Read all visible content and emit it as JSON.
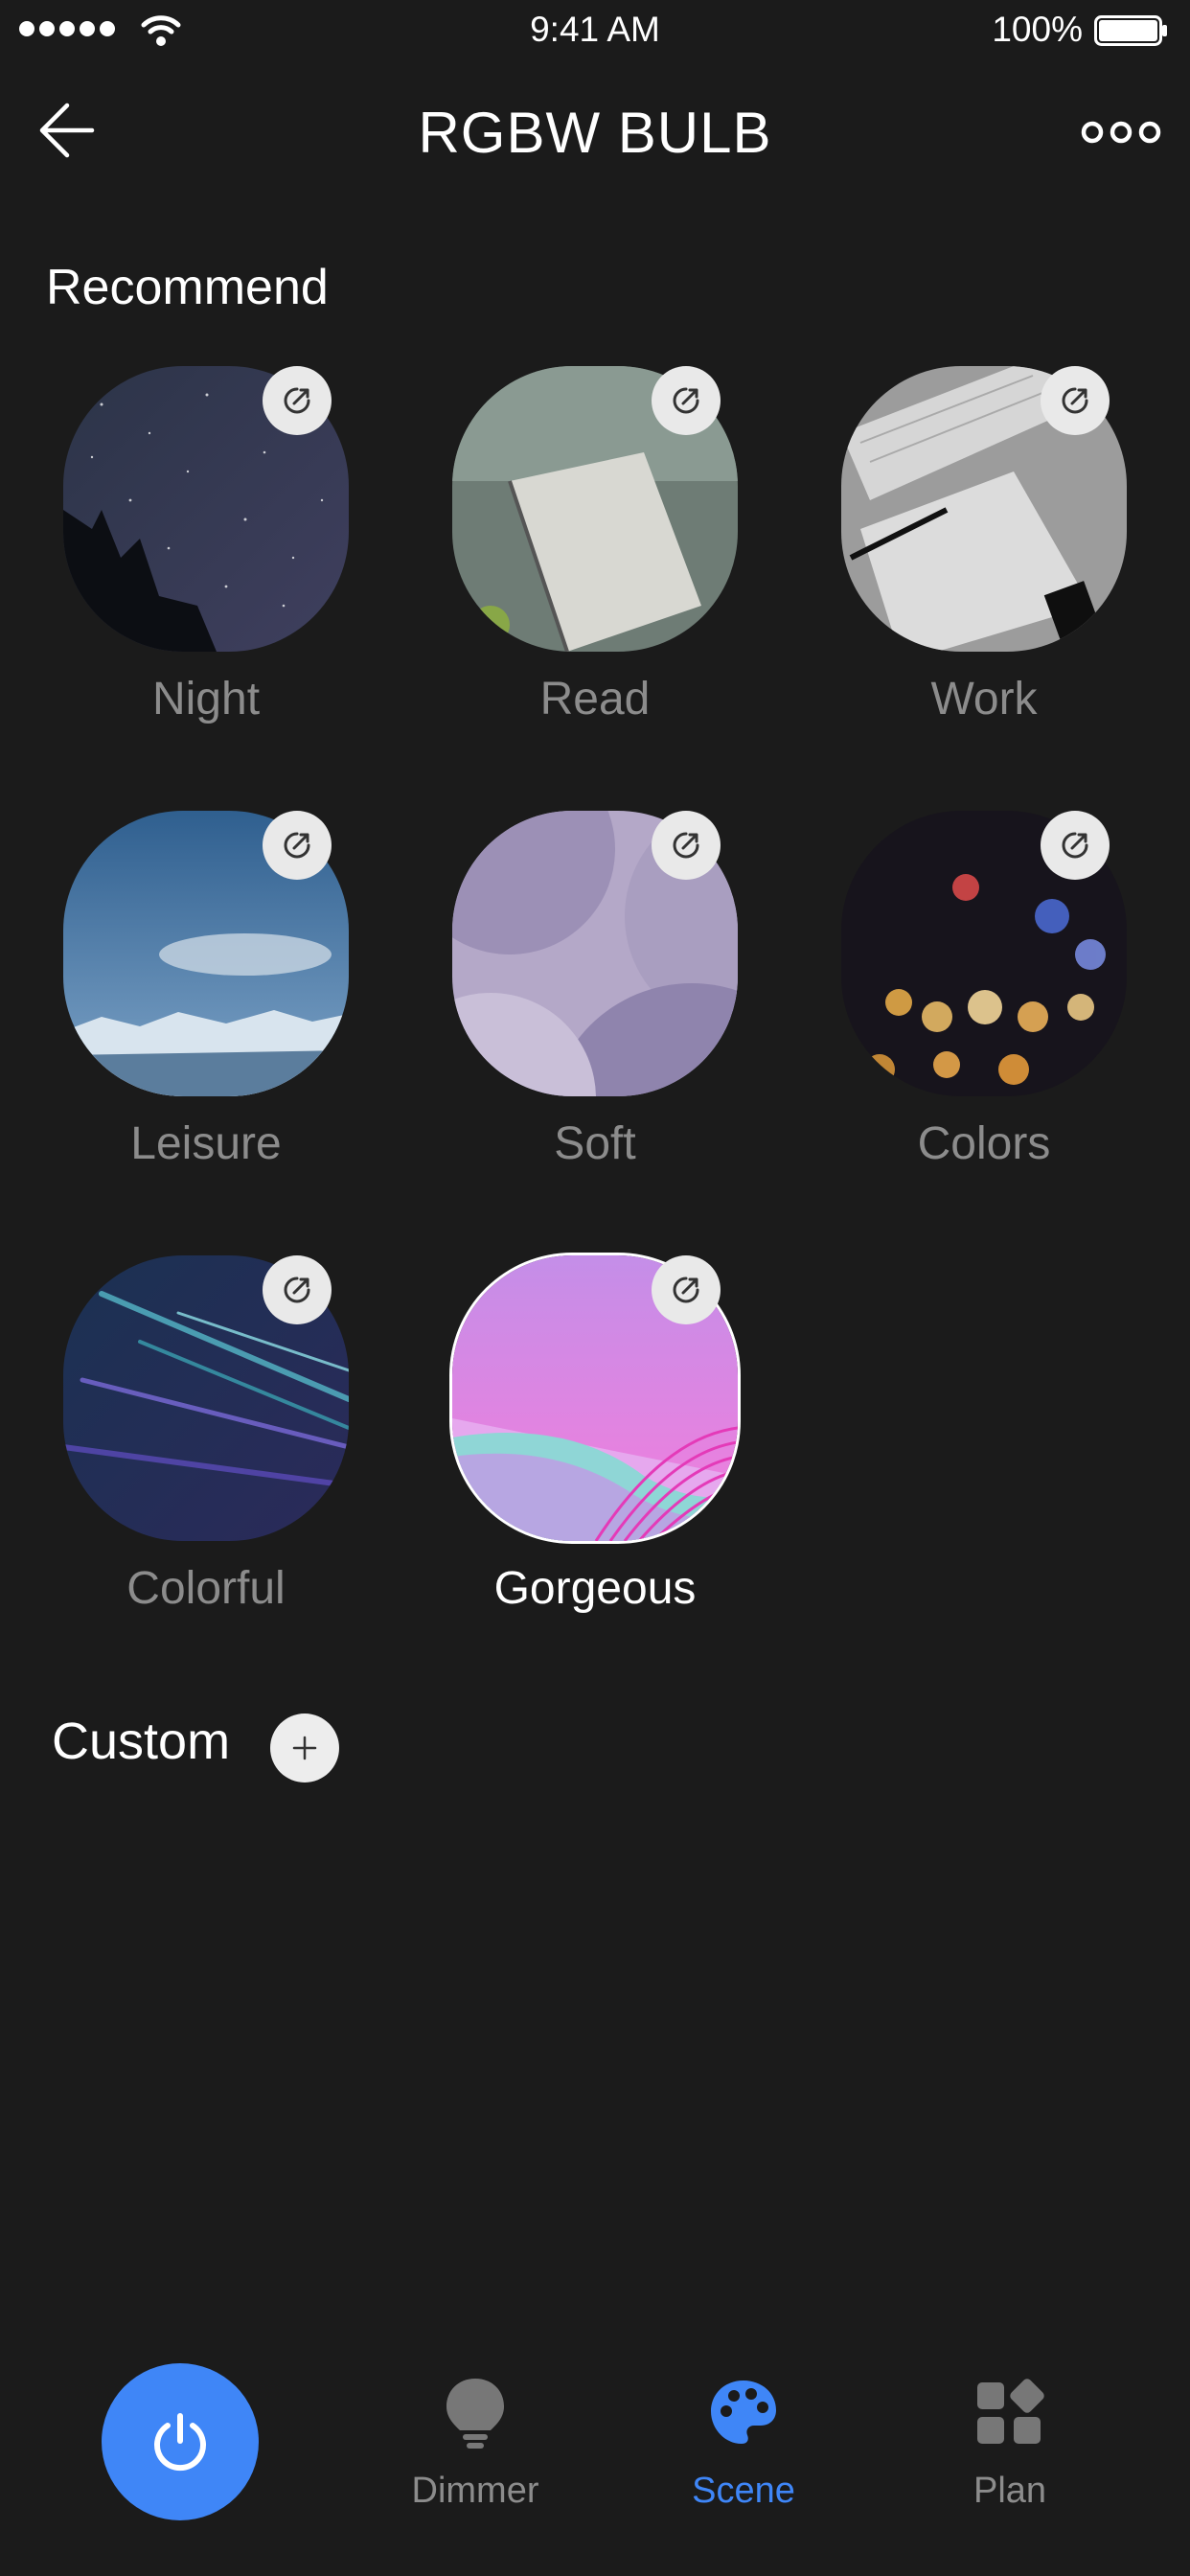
{
  "status_bar": {
    "time": "9:41 AM",
    "battery": "100%"
  },
  "header": {
    "title": "RGBW BULB"
  },
  "recommend": {
    "title": "Recommend",
    "scenes": [
      {
        "label": "Night"
      },
      {
        "label": "Read"
      },
      {
        "label": "Work"
      },
      {
        "label": "Leisure"
      },
      {
        "label": "Soft"
      },
      {
        "label": "Colors"
      },
      {
        "label": "Colorful"
      },
      {
        "label": "Gorgeous",
        "selected": true
      }
    ]
  },
  "custom": {
    "title": "Custom"
  },
  "tab_bar": {
    "tabs": [
      {
        "label": "Dimmer",
        "icon": "bulb-icon"
      },
      {
        "label": "Scene",
        "icon": "palette-icon",
        "active": true
      },
      {
        "label": "Plan",
        "icon": "grid-icon"
      }
    ]
  },
  "colors": {
    "accent": "#3f86f7",
    "background": "#1b1b1b",
    "inactive_text": "#8c8c8c"
  }
}
